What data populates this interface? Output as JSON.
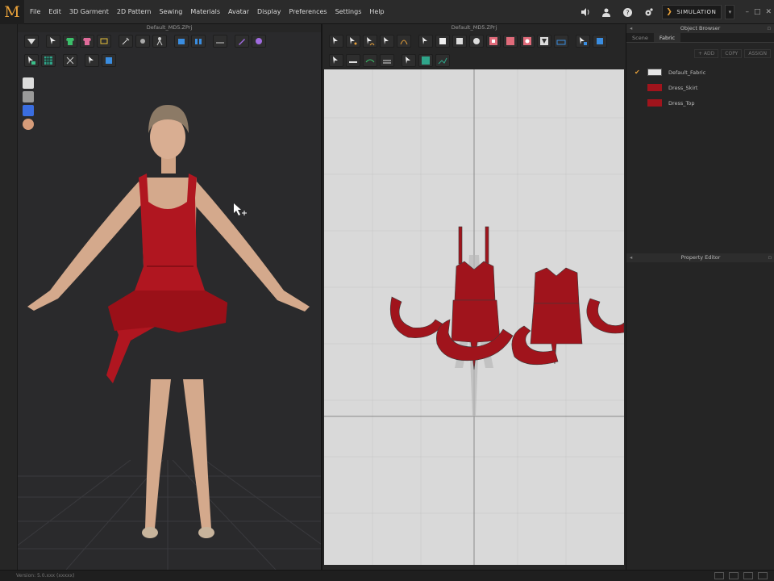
{
  "app": {
    "logo": "M",
    "menu": [
      "File",
      "Edit",
      "3D Garment",
      "2D Pattern",
      "Sewing",
      "Materials",
      "Avatar",
      "Display",
      "Preferences",
      "Settings",
      "Help"
    ],
    "simulation_label": "SIMULATION",
    "simulation_dropdown": "▾"
  },
  "view3d": {
    "title": "Default_MD5.ZPrj"
  },
  "view2d": {
    "title": "Default_MD5.ZPrj"
  },
  "object_browser": {
    "title": "Object Browser",
    "tabs": [
      "Scene",
      "Fabric"
    ],
    "active_tab": "Fabric",
    "actions": [
      "+ ADD",
      "COPY",
      "ASSIGN"
    ],
    "fabrics": [
      {
        "name": "Default_Fabric",
        "color": "#e6e6e6",
        "checked": true
      },
      {
        "name": "Dress_Skirt",
        "color": "#a0141c",
        "checked": false
      },
      {
        "name": "Dress_Top",
        "color": "#a0141c",
        "checked": false
      }
    ]
  },
  "property_editor": {
    "title": "Property Editor"
  },
  "status": {
    "text": "Version: 5.0.xxx    (xxxxx)"
  },
  "colors": {
    "accent": "#e8a13a",
    "dress": "#b01620",
    "canvas": "#d9d9d9",
    "skin": "#d7ab8e"
  },
  "icons": [
    "volume-icon",
    "user-icon",
    "help-icon",
    "settings-icon",
    "simulation-icon",
    "minimize-icon",
    "maximize-icon",
    "close-icon"
  ]
}
